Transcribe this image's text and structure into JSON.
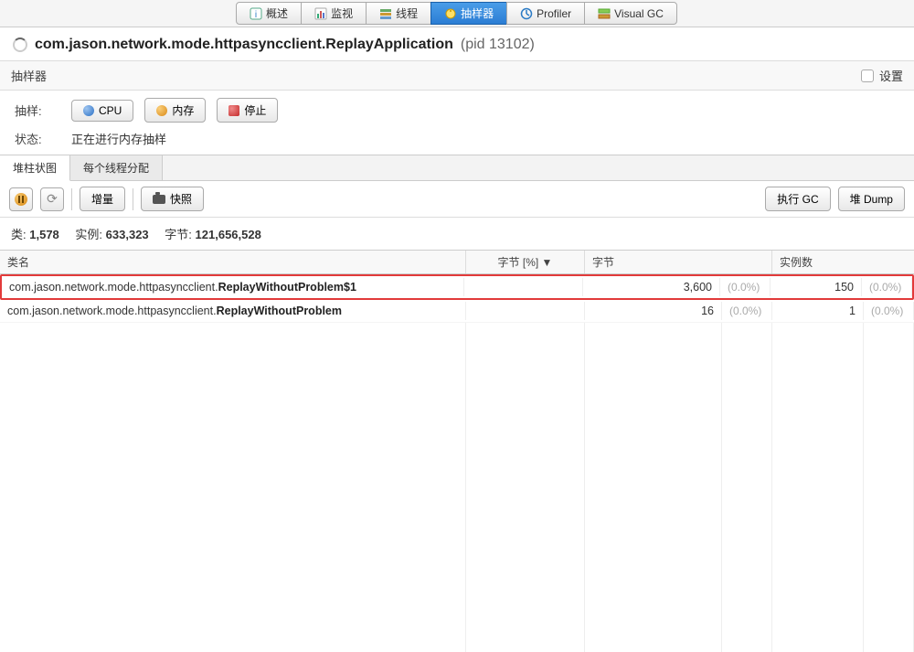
{
  "topNav": {
    "items": [
      {
        "label": "概述"
      },
      {
        "label": "监视"
      },
      {
        "label": "线程"
      },
      {
        "label": "抽样器"
      },
      {
        "label": "Profiler"
      },
      {
        "label": "Visual GC"
      }
    ]
  },
  "title": {
    "main": "com.jason.network.mode.httpasyncclient.ReplayApplication",
    "pid": "(pid 13102)"
  },
  "subHeader": {
    "left": "抽样器",
    "settingsLabel": "设置"
  },
  "sampling": {
    "label": "抽样:",
    "cpuBtn": "CPU",
    "memBtn": "内存",
    "stopBtn": "停止"
  },
  "status": {
    "label": "状态:",
    "value": "正在进行内存抽样"
  },
  "innerTabs": {
    "items": [
      "堆柱状图",
      "每个线程分配"
    ]
  },
  "toolbar": {
    "incrBtn": "增量",
    "snapBtn": "快照",
    "gcBtn": "执行 GC",
    "dumpBtn": "堆 Dump"
  },
  "stats": {
    "classesLabel": "类:",
    "classesValue": "1,578",
    "instancesLabel": "实例:",
    "instancesValue": "633,323",
    "bytesLabel": "字节:",
    "bytesValue": "121,656,528"
  },
  "table": {
    "headers": {
      "name": "类名",
      "pct": "字节 [%] ▼",
      "bytes": "字节",
      "count": "实例数"
    },
    "rows": [
      {
        "prefix": "com.jason.network.mode.httpasyncclient.",
        "bold": "ReplayWithoutProblem$1",
        "bytes": "3,600",
        "bytesPct": "(0.0%)",
        "count": "150",
        "countPct": "(0.0%)",
        "highlighted": true
      },
      {
        "prefix": "com.jason.network.mode.httpasyncclient.",
        "bold": "ReplayWithoutProblem",
        "bytes": "16",
        "bytesPct": "(0.0%)",
        "count": "1",
        "countPct": "(0.0%)",
        "highlighted": false
      }
    ]
  }
}
